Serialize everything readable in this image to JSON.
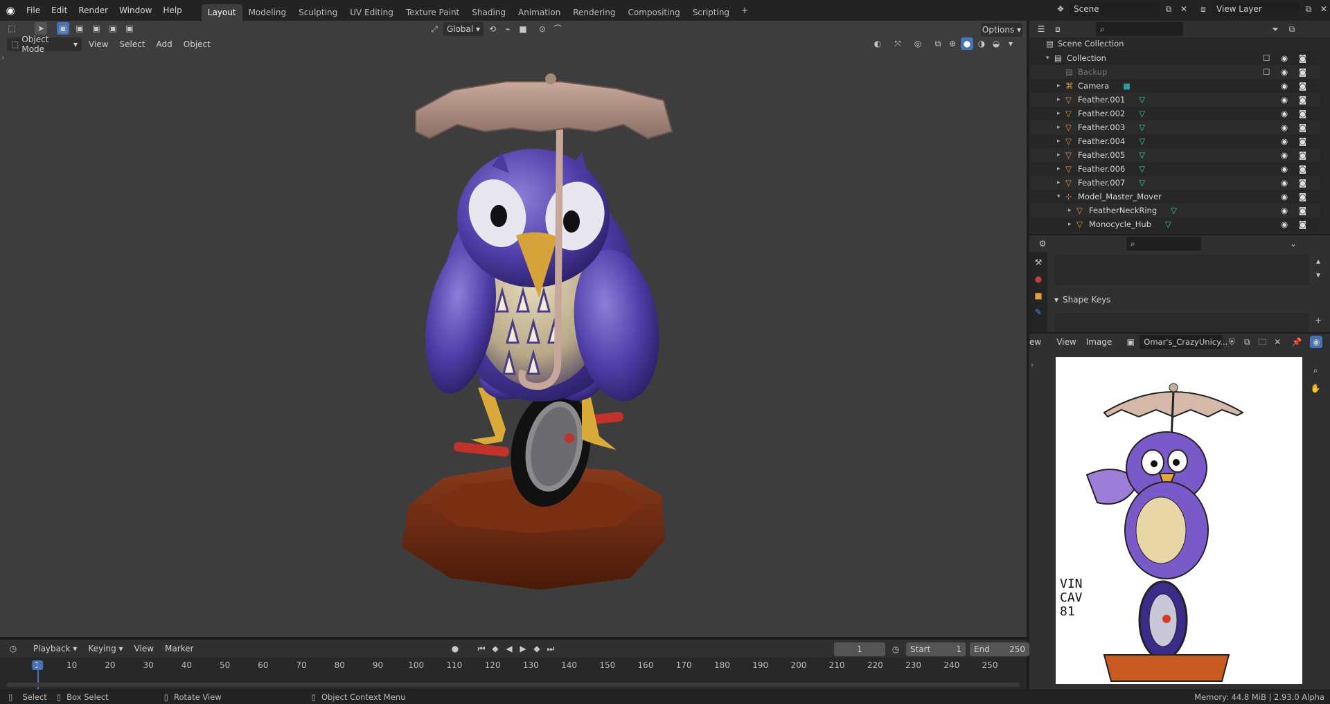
{
  "menu": {
    "items": [
      "File",
      "Edit",
      "Render",
      "Window",
      "Help"
    ]
  },
  "workspaces": [
    "Layout",
    "Modeling",
    "Sculpting",
    "UV Editing",
    "Texture Paint",
    "Shading",
    "Animation",
    "Rendering",
    "Compositing",
    "Scripting"
  ],
  "active_workspace": "Layout",
  "scene": {
    "name": "Scene",
    "view_layer": "View Layer"
  },
  "viewport": {
    "mode": "Object Mode",
    "menus": [
      "View",
      "Select",
      "Add",
      "Object"
    ],
    "transform_orientation": "Global",
    "options_label": "Options"
  },
  "outliner": {
    "root": "Scene Collection",
    "items": [
      {
        "label": "Collection",
        "indent": 1,
        "type": "collection"
      },
      {
        "label": "Backup",
        "indent": 2,
        "type": "collection-disabled"
      },
      {
        "label": "Camera",
        "indent": 2,
        "type": "camera"
      },
      {
        "label": "Feather.001",
        "indent": 2,
        "type": "mesh"
      },
      {
        "label": "Feather.002",
        "indent": 2,
        "type": "mesh"
      },
      {
        "label": "Feather.003",
        "indent": 2,
        "type": "mesh"
      },
      {
        "label": "Feather.004",
        "indent": 2,
        "type": "mesh"
      },
      {
        "label": "Feather.005",
        "indent": 2,
        "type": "mesh"
      },
      {
        "label": "Feather.006",
        "indent": 2,
        "type": "mesh"
      },
      {
        "label": "Feather.007",
        "indent": 2,
        "type": "mesh"
      },
      {
        "label": "Model_Master_Mover",
        "indent": 2,
        "type": "empty"
      },
      {
        "label": "FeatherNeckRing",
        "indent": 3,
        "type": "mesh"
      },
      {
        "label": "Monocycle_Hub",
        "indent": 3,
        "type": "mesh"
      }
    ]
  },
  "properties": {
    "section": "Shape Keys"
  },
  "image_editor": {
    "header_cut": "ew",
    "menus": [
      "View",
      "Image"
    ],
    "image_name": "Omar's_CrazyUnicy...",
    "signature": [
      "VIN",
      "CAV",
      "81"
    ]
  },
  "timeline": {
    "menus": [
      "Playback",
      "Keying",
      "View",
      "Marker"
    ],
    "current_frame": "1",
    "start_label": "Start",
    "start": "1",
    "end_label": "End",
    "end": "250",
    "ticks": [
      "1",
      "10",
      "20",
      "30",
      "40",
      "50",
      "60",
      "70",
      "80",
      "90",
      "100",
      "110",
      "120",
      "130",
      "140",
      "150",
      "160",
      "170",
      "180",
      "190",
      "200",
      "210",
      "220",
      "230",
      "240",
      "250"
    ]
  },
  "statusbar": {
    "select": "Select",
    "box_select": "Box Select",
    "rotate": "Rotate View",
    "context_menu": "Object Context Menu",
    "info": "Memory: 44.8 MiB | 2.93.0 Alpha"
  },
  "colors": {
    "accent": "#4772b3",
    "mesh_icon": "#e69c45",
    "data_icon": "#3fd28b"
  }
}
